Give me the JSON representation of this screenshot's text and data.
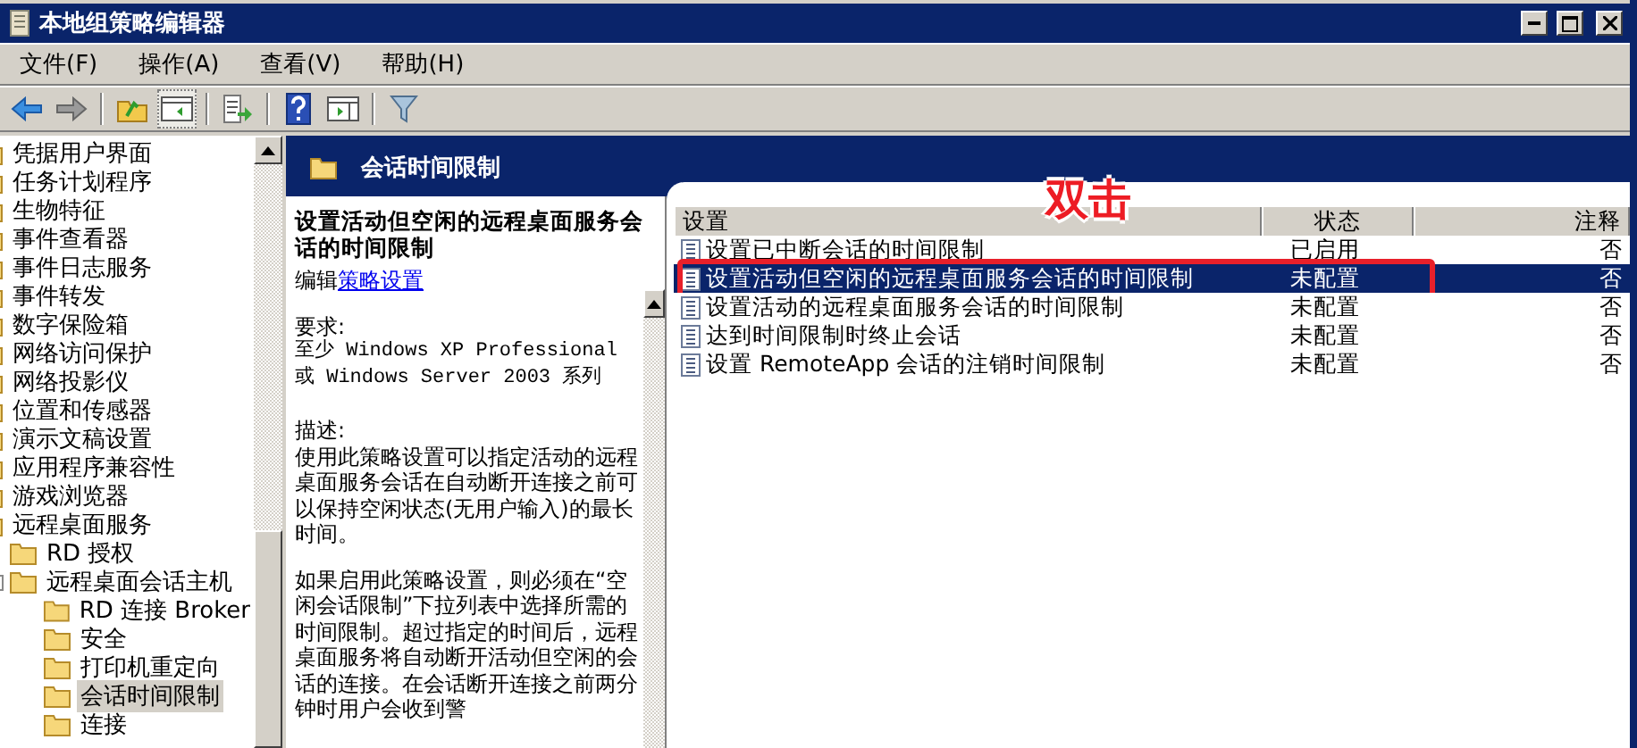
{
  "window": {
    "title": "本地组策略编辑器"
  },
  "menu": [
    {
      "label": "文件(F)"
    },
    {
      "label": "操作(A)"
    },
    {
      "label": "查看(V)"
    },
    {
      "label": "帮助(H)"
    }
  ],
  "toolbar": [
    {
      "kind": "back",
      "pressed": false
    },
    {
      "kind": "forward",
      "pressed": false
    },
    {
      "kind": "sep"
    },
    {
      "kind": "up",
      "pressed": false
    },
    {
      "kind": "tree",
      "pressed": true
    },
    {
      "kind": "sep"
    },
    {
      "kind": "export",
      "pressed": false
    },
    {
      "kind": "sep"
    },
    {
      "kind": "help",
      "pressed": false
    },
    {
      "kind": "pane",
      "pressed": false
    },
    {
      "kind": "sep"
    },
    {
      "kind": "filter",
      "pressed": false
    }
  ],
  "tree": {
    "items": [
      {
        "label": "凭据用户界面",
        "selected": false
      },
      {
        "label": "任务计划程序",
        "selected": false
      },
      {
        "label": "生物特征",
        "selected": false
      },
      {
        "label": "事件查看器",
        "selected": false
      },
      {
        "label": "事件日志服务",
        "selected": false
      },
      {
        "label": "事件转发",
        "selected": false
      },
      {
        "label": "数字保险箱",
        "selected": false
      },
      {
        "label": "网络访问保护",
        "selected": false
      },
      {
        "label": "网络投影仪",
        "selected": false
      },
      {
        "label": "位置和传感器",
        "selected": false
      },
      {
        "label": "演示文稿设置",
        "selected": false
      },
      {
        "label": "应用程序兼容性",
        "selected": false
      },
      {
        "label": "游戏浏览器",
        "selected": false
      },
      {
        "label": "远程桌面服务",
        "selected": false,
        "children": [
          {
            "label": "RD 授权",
            "selected": false
          },
          {
            "label": "远程桌面会话主机",
            "selected": false,
            "children": [
              {
                "label": "RD 连接 Broker",
                "selected": false
              },
              {
                "label": "安全",
                "selected": false
              },
              {
                "label": "打印机重定向",
                "selected": false
              },
              {
                "label": "会话时间限制",
                "selected": true
              },
              {
                "label": "连接",
                "selected": false
              }
            ]
          }
        ]
      }
    ]
  },
  "header": {
    "title": "会话时间限制"
  },
  "description": {
    "title": "设置活动但空闲的远程桌面服务会话的时间限制",
    "edit_prefix": "编辑",
    "edit_link": "策略设置",
    "requirements_label": "要求:",
    "requirements": [
      "至少 Windows XP Professional",
      "或 Windows Server 2003 系列"
    ],
    "description_label": "描述:",
    "paragraphs": [
      "使用此策略设置可以指定活动的远程桌面服务会话在自动断开连接之前可以保持空闲状态(无用户输入)的最长时间。",
      "如果启用此策略设置，则必须在“空闲会话限制”下拉列表中选择所需的时间限制。超过指定的时间后，远程桌面服务将自动断开活动但空闲的会话的连接。在会话断开连接之前两分钟时用户会收到警"
    ]
  },
  "list": {
    "columns": [
      "设置",
      "状态",
      "注释"
    ],
    "rows": [
      {
        "name": "设置已中断会话的时间限制",
        "state": "已启用",
        "comment": "否",
        "selected": false,
        "highlighted": false
      },
      {
        "name": "设置活动但空闲的远程桌面服务会话的时间限制",
        "state": "未配置",
        "comment": "否",
        "selected": true,
        "highlighted": true
      },
      {
        "name": "设置活动的远程桌面服务会话的时间限制",
        "state": "未配置",
        "comment": "否",
        "selected": false,
        "highlighted": false
      },
      {
        "name": "达到时间限制时终止会话",
        "state": "未配置",
        "comment": "否",
        "selected": false,
        "highlighted": false
      },
      {
        "name": "设置 RemoteApp 会话的注销时间限制",
        "state": "未配置",
        "comment": "否",
        "selected": false,
        "highlighted": false
      }
    ]
  },
  "annotation": {
    "text": "双击"
  }
}
